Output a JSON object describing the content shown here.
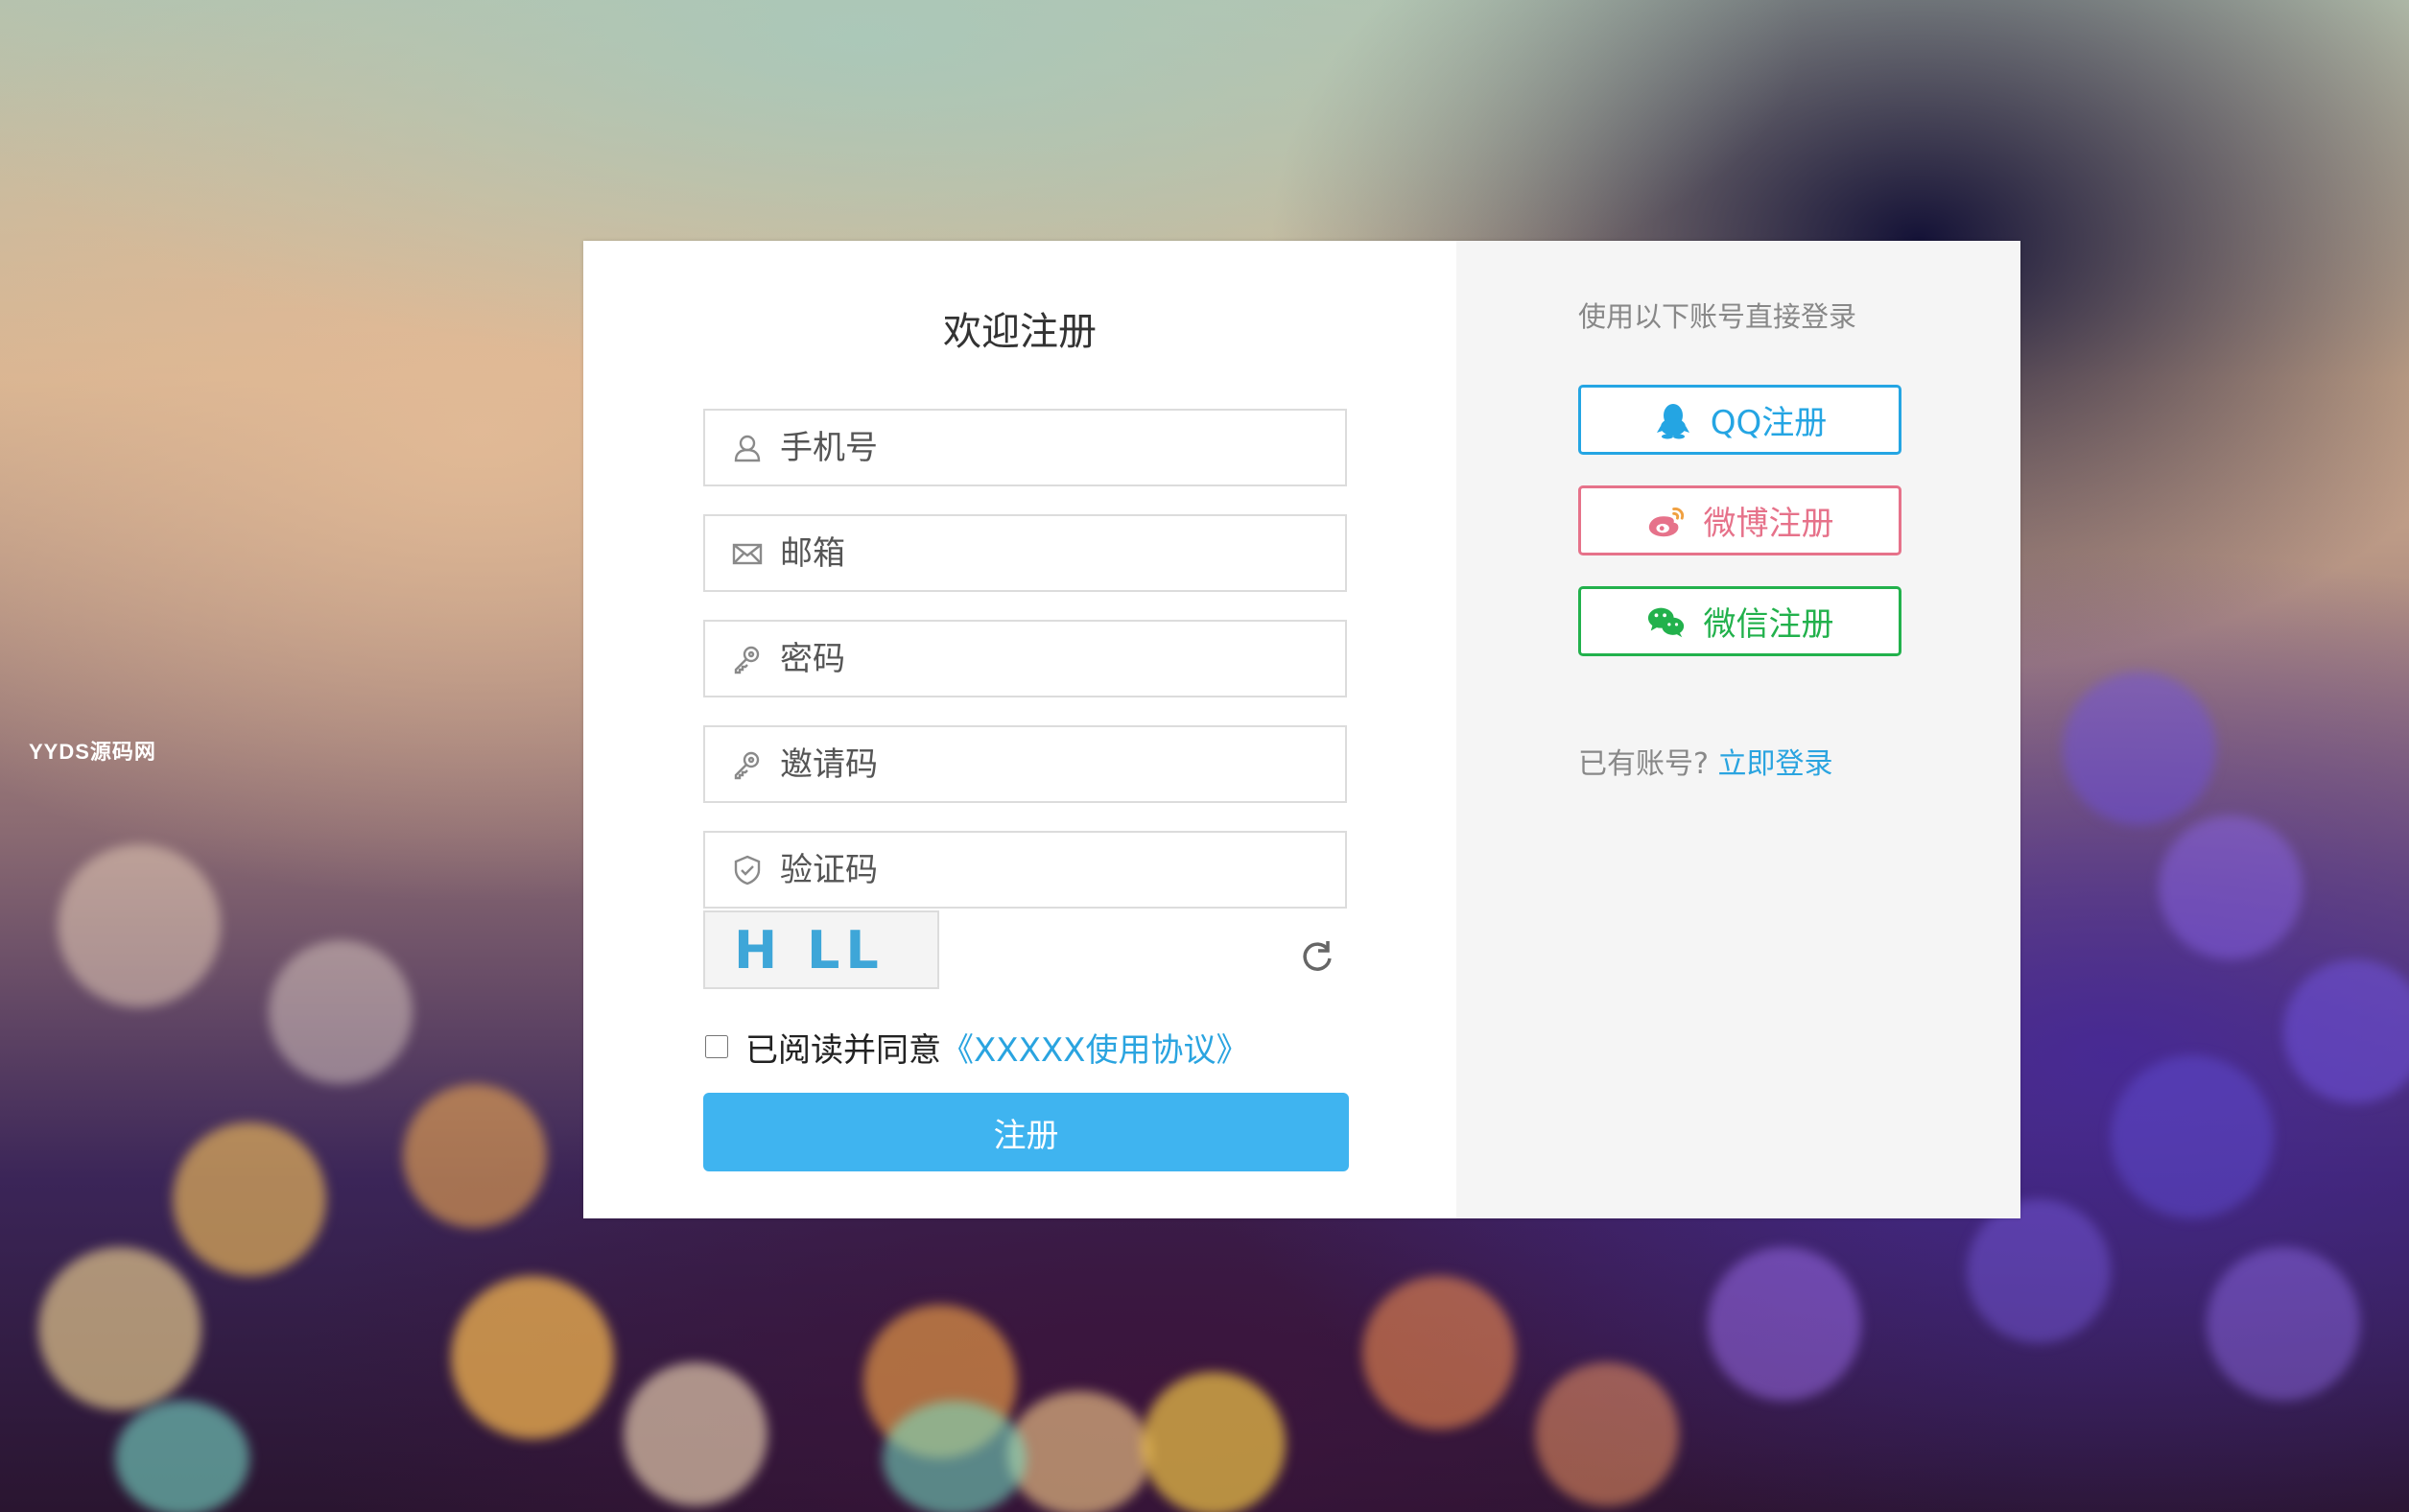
{
  "watermark": "YYDS源码网",
  "register": {
    "title": "欢迎注册",
    "fields": [
      {
        "placeholder": "手机号",
        "icon": "user-icon"
      },
      {
        "placeholder": "邮箱",
        "icon": "mail-icon"
      },
      {
        "placeholder": "密码",
        "icon": "key-icon"
      },
      {
        "placeholder": "邀请码",
        "icon": "key-icon"
      },
      {
        "placeholder": "验证码",
        "icon": "shield-icon"
      }
    ],
    "captcha_text": "H LL",
    "agree_text": "已阅读并同意",
    "agreement_link": "《XXXXX使用协议》",
    "submit_label": "注册"
  },
  "social": {
    "hint": "使用以下账号直接登录",
    "buttons": [
      {
        "label": "QQ注册",
        "icon": "qq-penguin-icon",
        "color": "#24a5e3"
      },
      {
        "label": "微博注册",
        "icon": "weibo-icon",
        "color": "#e6728a"
      },
      {
        "label": "微信注册",
        "icon": "wechat-icon",
        "color": "#22b14c"
      }
    ],
    "has_account_text": "已有账号?",
    "login_link": "立即登录"
  }
}
